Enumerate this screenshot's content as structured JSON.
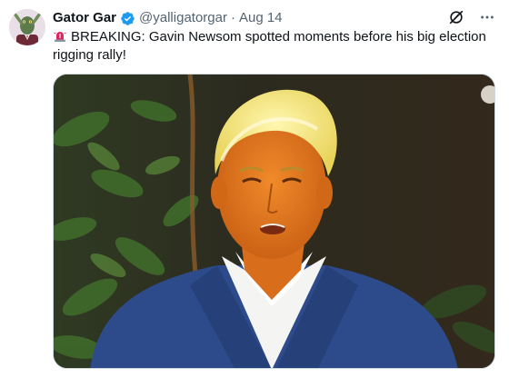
{
  "author": {
    "display_name": "Gator Gar",
    "handle": "@yalligatorgar",
    "verified": true,
    "avatar_icon": "alligator-avatar"
  },
  "meta": {
    "separator": "·",
    "date": "Aug 14"
  },
  "post": {
    "emoji_icon": "siren-icon",
    "text": "BREAKING: Gavin Newsom spotted moments before his big election rigging rally!"
  },
  "colors": {
    "verified_blue": "#1d9bf0",
    "secondary_text": "#536471",
    "primary_text": "#0f1419",
    "border": "#cfd9de"
  },
  "icons": {
    "grok": "grok-icon",
    "more": "more-icon"
  }
}
